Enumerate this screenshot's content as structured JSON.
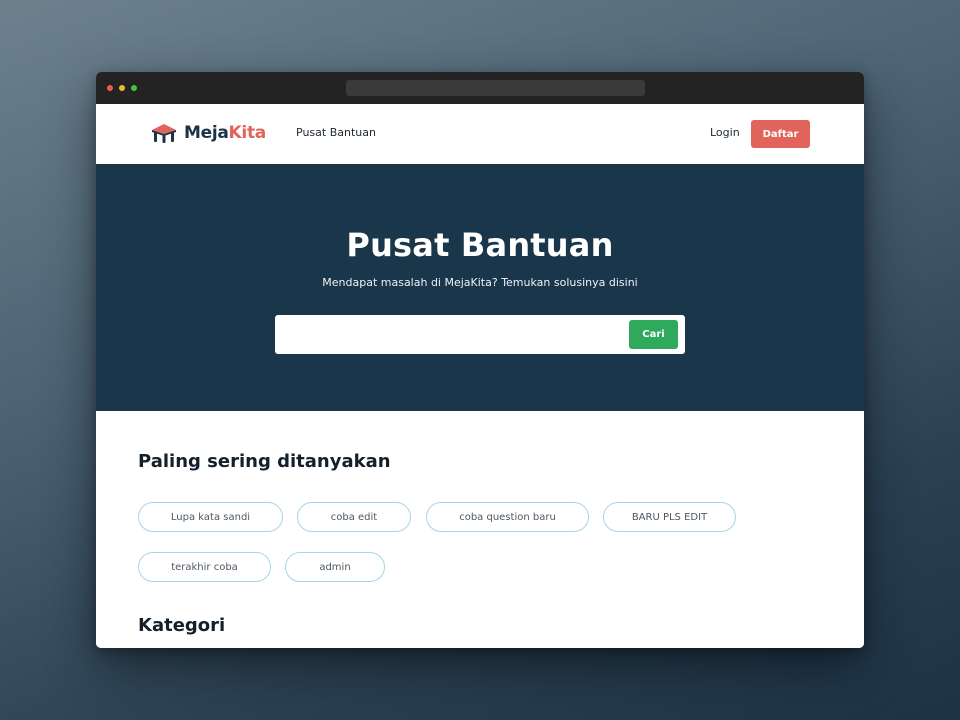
{
  "brand": {
    "name_part1": "Meja",
    "name_part2": "Kita",
    "color_dark": "#1c3346",
    "color_accent": "#e0645a"
  },
  "navbar": {
    "link": "Pusat Bantuan",
    "login": "Login",
    "register": "Daftar"
  },
  "hero": {
    "title": "Pusat Bantuan",
    "subtitle": "Mendapat masalah di MejaKita? Temukan solusinya disini",
    "search_value": "",
    "search_button": "Cari"
  },
  "faq": {
    "title": "Paling sering ditanyakan",
    "items": [
      "Lupa kata sandi",
      "coba edit",
      "coba question baru",
      "BARU PLS EDIT",
      "terakhir coba",
      "admin"
    ]
  },
  "categories": {
    "title": "Kategori"
  },
  "colors": {
    "hero_bg": "#19364a",
    "search_button": "#2faa5c",
    "chip_border": "#a6d5e6"
  }
}
